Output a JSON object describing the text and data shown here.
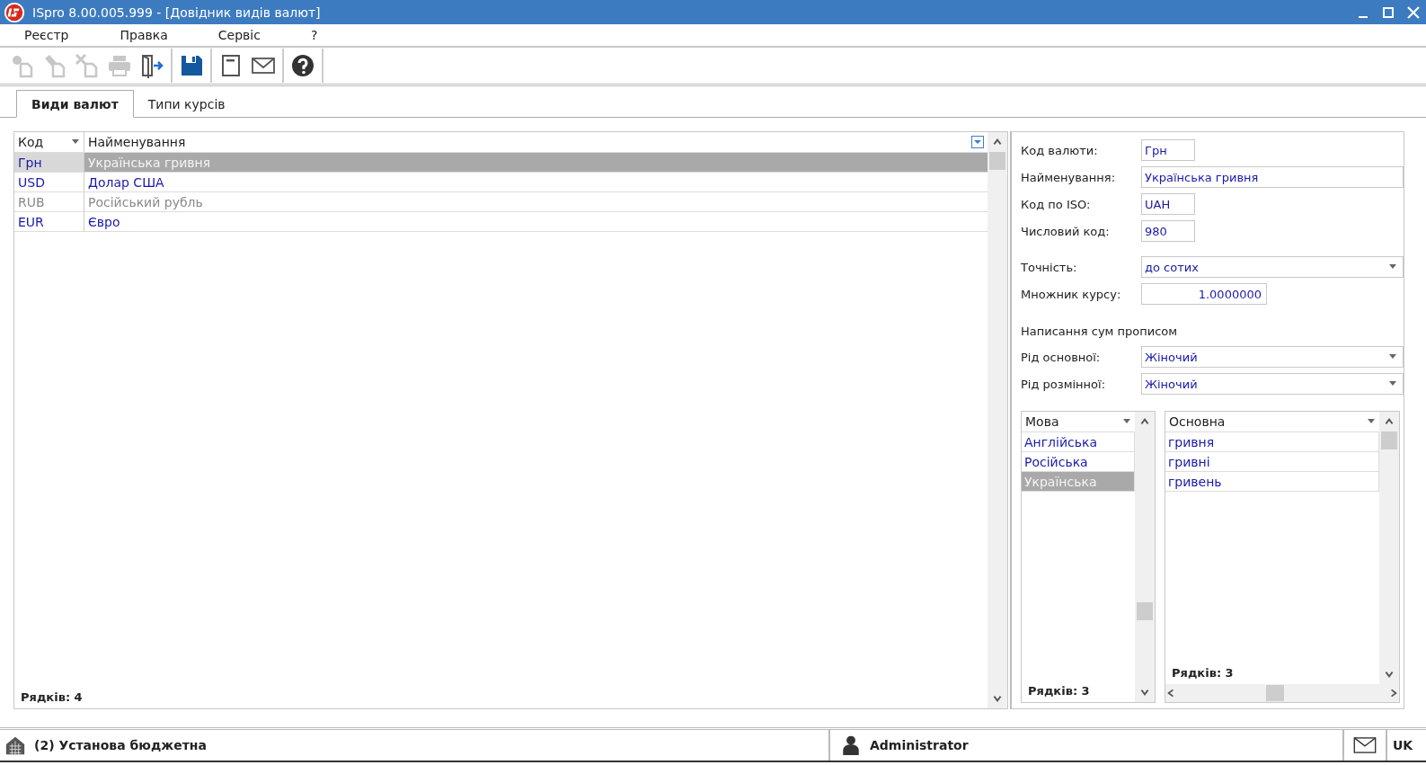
{
  "window": {
    "title": "ISpro 8.00.005.999 - [Довідник видів валют]"
  },
  "menu": [
    "Реєстр",
    "Правка",
    "Сервіс",
    "?"
  ],
  "toolbar": [
    [
      {
        "kind": "add",
        "disabled": true
      },
      {
        "kind": "edit",
        "disabled": true
      },
      {
        "kind": "delete",
        "disabled": true
      },
      {
        "kind": "print",
        "disabled": true
      },
      {
        "kind": "exit",
        "disabled": false
      }
    ],
    [
      {
        "kind": "save",
        "disabled": false
      }
    ],
    [
      {
        "kind": "notebook",
        "disabled": false
      },
      {
        "kind": "mail",
        "disabled": false
      }
    ],
    [
      {
        "kind": "help",
        "disabled": false
      }
    ]
  ],
  "tabs": [
    {
      "label": "Види валют",
      "selected": true
    },
    {
      "label": "Типи курсів",
      "selected": false
    }
  ],
  "table": {
    "columns": [
      "Код",
      "Найменування"
    ],
    "rows": [
      {
        "code": "Грн",
        "name": "Українська гривня",
        "selected": true,
        "disabled": false
      },
      {
        "code": "USD",
        "name": "Долар США",
        "selected": false,
        "disabled": false
      },
      {
        "code": "RUB",
        "name": "Російський рубль",
        "selected": false,
        "disabled": true
      },
      {
        "code": "EUR",
        "name": "Євро",
        "selected": false,
        "disabled": false
      }
    ],
    "footer": "Рядків: 4"
  },
  "form_groups": [
    {
      "fields": [
        {
          "label": "Код валюти:",
          "value": "Грн",
          "kind": "short"
        },
        {
          "label": "Найменування:",
          "value": "Українська гривня",
          "kind": "wide"
        },
        {
          "label": "Код по ISO:",
          "value": "UAH",
          "kind": "short"
        },
        {
          "label": "Числовий код:",
          "value": "980",
          "kind": "short"
        }
      ]
    },
    {
      "fields": [
        {
          "label": "Точність:",
          "value": "до сотих",
          "kind": "dropdown"
        },
        {
          "label": "Множник курсу:",
          "value": "1.0000000",
          "kind": "number"
        }
      ]
    },
    {
      "heading": "Написання сум прописом",
      "fields": [
        {
          "label": "Рід основної:",
          "value": "Жіночий",
          "kind": "dropdown"
        },
        {
          "label": "Рід розмінної:",
          "value": "Жіночий",
          "kind": "dropdown"
        }
      ]
    }
  ],
  "languages": {
    "column": "Мова",
    "rows": [
      {
        "text": "Англійська",
        "selected": false
      },
      {
        "text": "Російська",
        "selected": false
      },
      {
        "text": "Українська",
        "selected": true
      }
    ],
    "footer": "Рядків: 3"
  },
  "word_forms": {
    "column": "Основна",
    "rows": [
      {
        "text": "гривня",
        "selected": false
      },
      {
        "text": "гривні",
        "selected": false
      },
      {
        "text": "гривень",
        "selected": false
      }
    ],
    "footer": "Рядків: 3"
  },
  "status_bar": {
    "organization": "(2) Установа бюджетна",
    "user": "Administrator",
    "language": "UK"
  }
}
